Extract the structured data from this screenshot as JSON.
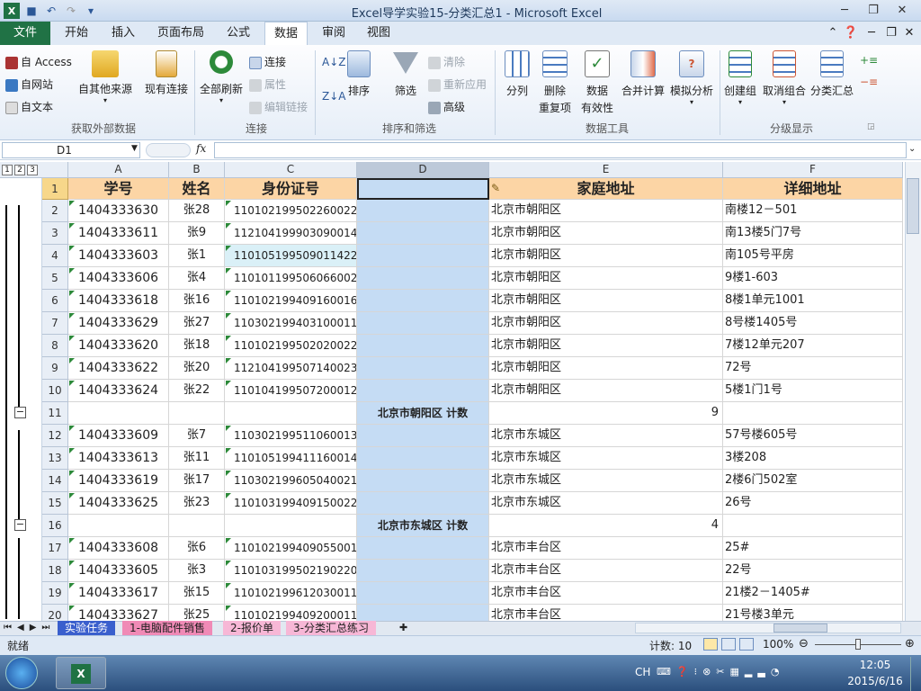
{
  "window": {
    "title": "Excel导学实验15-分类汇总1 - Microsoft Excel"
  },
  "ribbon_tabs": [
    "文件",
    "开始",
    "插入",
    "页面布局",
    "公式",
    "数据",
    "审阅",
    "视图"
  ],
  "groups": {
    "external": {
      "label": "获取外部数据",
      "access": "自 Access",
      "web": "自网站",
      "text": "自文本",
      "other": "自其他来源",
      "existing": "现有连接"
    },
    "connections": {
      "label": "连接",
      "refresh": "全部刷新",
      "conn": "连接",
      "props": "属性",
      "edit": "编辑链接"
    },
    "sortfilter": {
      "label": "排序和筛选",
      "sort": "排序",
      "filter": "筛选",
      "clear": "清除",
      "reapply": "重新应用",
      "advanced": "高级"
    },
    "datatools": {
      "label": "数据工具",
      "split": "分列",
      "dedup1": "删除",
      "dedup2": "重复项",
      "valid1": "数据",
      "valid2": "有效性",
      "consolidate": "合并计算",
      "whatif": "模拟分析"
    },
    "outline": {
      "label": "分级显示",
      "group": "创建组",
      "ungroup": "取消组合",
      "subtotal": "分类汇总"
    }
  },
  "namebox": "D1",
  "fx": "fx",
  "columns": [
    "A",
    "B",
    "C",
    "D",
    "E",
    "F"
  ],
  "outline_levels": [
    "1",
    "2",
    "3"
  ],
  "headers": [
    "学号",
    "姓名",
    "身份证号",
    "",
    "家庭地址",
    "详细地址"
  ],
  "rows": [
    {
      "n": "2",
      "a": "1404333630",
      "b": "张28",
      "c": "110102199502260022",
      "d": "",
      "e": "北京市朝阳区",
      "f": "南楼12－501"
    },
    {
      "n": "3",
      "a": "1404333611",
      "b": "张9",
      "c": "112104199903090014",
      "d": "",
      "e": "北京市朝阳区",
      "f": "南13楼5门7号"
    },
    {
      "n": "4",
      "a": "1404333603",
      "b": "张1",
      "c": "110105199509011422",
      "d": "",
      "e": "北京市朝阳区",
      "f": "南105号平房"
    },
    {
      "n": "5",
      "a": "1404333606",
      "b": "张4",
      "c": "110101199506066002",
      "d": "",
      "e": "北京市朝阳区",
      "f": "9楼1-603"
    },
    {
      "n": "6",
      "a": "1404333618",
      "b": "张16",
      "c": "110102199409160016",
      "d": "",
      "e": "北京市朝阳区",
      "f": "8楼1单元1001"
    },
    {
      "n": "7",
      "a": "1404333629",
      "b": "张27",
      "c": "110302199403100011",
      "d": "",
      "e": "北京市朝阳区",
      "f": "8号楼1405号"
    },
    {
      "n": "8",
      "a": "1404333620",
      "b": "张18",
      "c": "110102199502020022",
      "d": "",
      "e": "北京市朝阳区",
      "f": "7楼12单元207"
    },
    {
      "n": "9",
      "a": "1404333622",
      "b": "张20",
      "c": "112104199507140023",
      "d": "",
      "e": "北京市朝阳区",
      "f": "72号"
    },
    {
      "n": "10",
      "a": "1404333624",
      "b": "张22",
      "c": "110104199507200012",
      "d": "",
      "e": "北京市朝阳区",
      "f": "5楼1门1号"
    },
    {
      "n": "11",
      "a": "",
      "b": "",
      "c": "",
      "d": "北京市朝阳区 计数",
      "e": "9",
      "f": "",
      "sum": true
    },
    {
      "n": "12",
      "a": "1404333609",
      "b": "张7",
      "c": "110302199511060013",
      "d": "",
      "e": "北京市东城区",
      "f": "57号楼605号"
    },
    {
      "n": "13",
      "a": "1404333613",
      "b": "张11",
      "c": "110105199411160014",
      "d": "",
      "e": "北京市东城区",
      "f": "3楼208"
    },
    {
      "n": "14",
      "a": "1404333619",
      "b": "张17",
      "c": "110302199605040021",
      "d": "",
      "e": "北京市东城区",
      "f": "2楼6门502室"
    },
    {
      "n": "15",
      "a": "1404333625",
      "b": "张23",
      "c": "110103199409150022",
      "d": "",
      "e": "北京市东城区",
      "f": "26号"
    },
    {
      "n": "16",
      "a": "",
      "b": "",
      "c": "",
      "d": "北京市东城区 计数",
      "e": "4",
      "f": "",
      "sum": true
    },
    {
      "n": "17",
      "a": "1404333608",
      "b": "张6",
      "c": "110102199409055001",
      "d": "",
      "e": "北京市丰台区",
      "f": "25#"
    },
    {
      "n": "18",
      "a": "1404333605",
      "b": "张3",
      "c": "110103199502190220",
      "d": "",
      "e": "北京市丰台区",
      "f": "22号"
    },
    {
      "n": "19",
      "a": "1404333617",
      "b": "张15",
      "c": "110102199612030011",
      "d": "",
      "e": "北京市丰台区",
      "f": "21楼2－1405#"
    },
    {
      "n": "20",
      "a": "1404333627",
      "b": "张25",
      "c": "110102199409200011",
      "d": "",
      "e": "北京市丰台区",
      "f": "21号楼3单元"
    }
  ],
  "sheets": [
    "实验任务",
    "1-电脑配件销售",
    "2-报价单",
    "3-分类汇总练习"
  ],
  "status": {
    "ready": "就绪",
    "count": "计数: 10",
    "zoom": "100%"
  },
  "taskbar": {
    "lang": "CH",
    "time": "12:05",
    "date": "2015/6/16"
  }
}
